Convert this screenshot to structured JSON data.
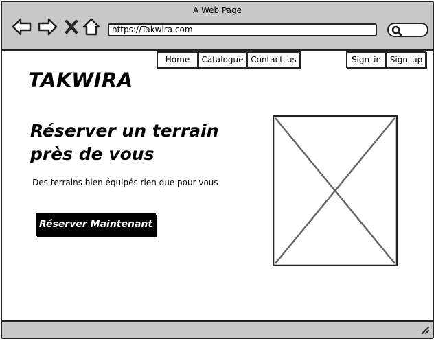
{
  "window": {
    "title": "A Web Page"
  },
  "browser": {
    "url": "https://Takwira.com",
    "back_icon": "arrow-left-icon",
    "forward_icon": "arrow-right-icon",
    "close_icon": "close-x-icon",
    "home_icon": "home-icon",
    "search_icon": "search-icon"
  },
  "nav": {
    "items": [
      {
        "label": "Home"
      },
      {
        "label": "Catalogue"
      },
      {
        "label": "Contact_us"
      }
    ],
    "auth": [
      {
        "label": "Sign_in"
      },
      {
        "label": "Sign_up"
      }
    ]
  },
  "brand": {
    "logo": "TAKWIRA"
  },
  "hero": {
    "headline_line1": "Réserver un terrain",
    "headline_line2": "près de vous",
    "subtitle": "Des terrains bien équipés rien que pour vous",
    "cta": "Réserver Maintenant"
  },
  "colors": {
    "chrome": "#c8c8c8",
    "button": "#000000",
    "ink": "#222222"
  }
}
